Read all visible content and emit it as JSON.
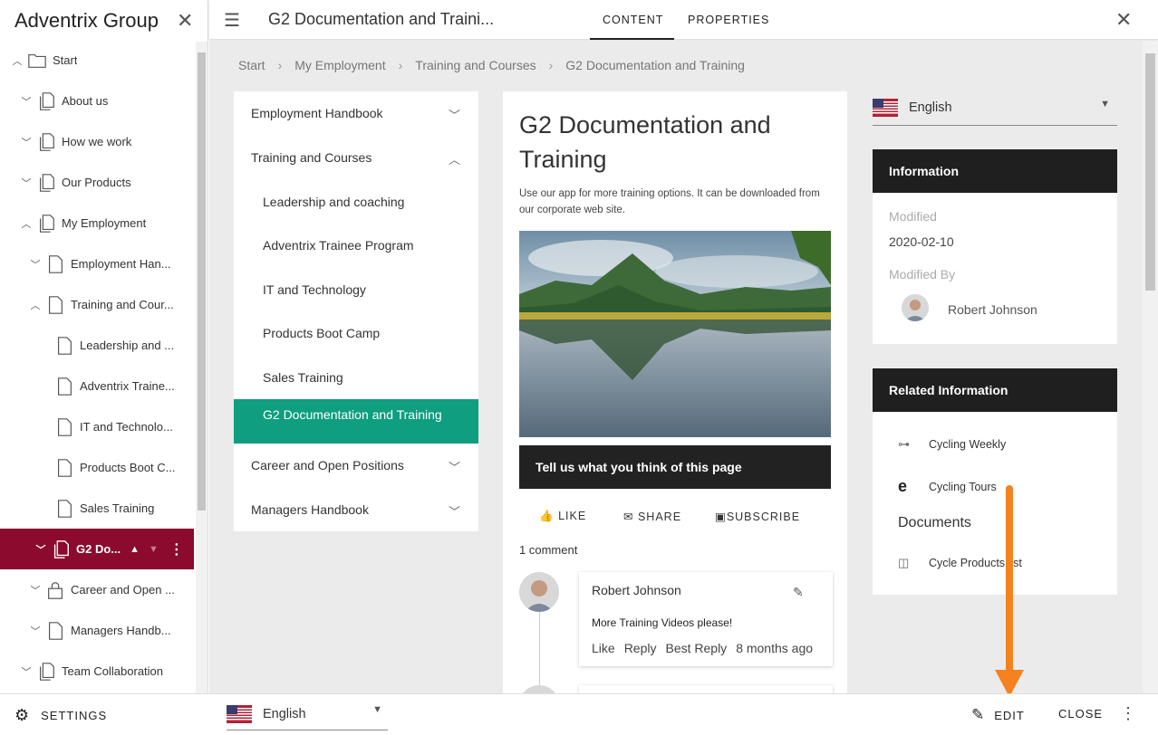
{
  "tree": {
    "title": "Adventrix Group",
    "items": [
      {
        "label": "Start",
        "chevron": "up",
        "icon": "folder-icon"
      },
      {
        "label": "About us",
        "chevron": "down",
        "icon": "pages-icon"
      },
      {
        "label": "How we work",
        "chevron": "down",
        "icon": "pages-icon"
      },
      {
        "label": "Our Products",
        "chevron": "down",
        "icon": "pages-icon"
      },
      {
        "label": "My Employment",
        "chevron": "up",
        "icon": "pages-icon"
      },
      {
        "label": "Employment Han...",
        "chevron": "down",
        "icon": "page-icon"
      },
      {
        "label": "Training and Cour...",
        "chevron": "up",
        "icon": "page-icon"
      },
      {
        "label": "Leadership and ...",
        "chevron": "",
        "icon": "page-icon"
      },
      {
        "label": "Adventrix Traine...",
        "chevron": "",
        "icon": "page-icon"
      },
      {
        "label": "IT and Technolo...",
        "chevron": "",
        "icon": "page-icon"
      },
      {
        "label": "Products Boot C...",
        "chevron": "",
        "icon": "page-icon"
      },
      {
        "label": "Sales Training",
        "chevron": "",
        "icon": "page-icon"
      },
      {
        "label": "G2 Do...",
        "chevron": "down",
        "icon": "pages-icon"
      },
      {
        "label": "Career and Open ...",
        "chevron": "down",
        "icon": "lock-icon"
      },
      {
        "label": "Managers Handb...",
        "chevron": "down",
        "icon": "page-icon"
      },
      {
        "label": "Team Collaboration",
        "chevron": "down",
        "icon": "pages-icon"
      }
    ]
  },
  "topbar": {
    "title": "G2 Documentation and Traini...",
    "tabs": [
      "CONTENT",
      "PROPERTIES"
    ]
  },
  "breadcrumb": [
    "Start",
    "My Employment",
    "Training and Courses",
    "G2 Documentation and Training"
  ],
  "nav": {
    "employment_handbook": "Employment Handbook",
    "training_and_courses": "Training and Courses",
    "subitems": [
      "Leadership and coaching",
      "Adventrix Trainee Program",
      "IT and Technology",
      "Products Boot Camp",
      "Sales Training"
    ],
    "active": "G2 Documentation and Training",
    "career": "Career and Open Positions",
    "managers": "Managers Handbook"
  },
  "card": {
    "title": "G2 Documentation and Training",
    "description": "Use our app for more training options. It can be downloaded from our corporate web site.",
    "feedback": "Tell us what you think of this page",
    "actions": {
      "like": "LIKE",
      "share": "SHARE",
      "subscribe": "SUBSCRIBE"
    },
    "comment_count": "1 comment",
    "comment": {
      "author": "Robert Johnson",
      "text": "More Training Videos please!",
      "like": "Like",
      "reply": "Reply",
      "best_reply": "Best Reply",
      "time": "8 months ago"
    }
  },
  "language": {
    "selected": "English"
  },
  "info": {
    "heading": "Information",
    "modified_label": "Modified",
    "modified_value": "2020-02-10",
    "modified_by_label": "Modified By",
    "modified_by_value": "Robert Johnson"
  },
  "related": {
    "heading": "Related Information",
    "links": [
      {
        "label": "Cycling Weekly",
        "icon": "link-icon"
      },
      {
        "label": "Cycling Tours",
        "icon": "edge-icon"
      }
    ],
    "documents_heading": "Documents",
    "documents": [
      {
        "label": "Cycle Products list",
        "icon": "book-icon"
      }
    ]
  },
  "bottombar": {
    "settings": "SETTINGS",
    "language": "English",
    "edit": "EDIT",
    "close": "CLOSE"
  },
  "colors": {
    "active_tree": "#8b0a2e",
    "active_nav": "#0f9e80",
    "arrow": "#f5821f"
  }
}
